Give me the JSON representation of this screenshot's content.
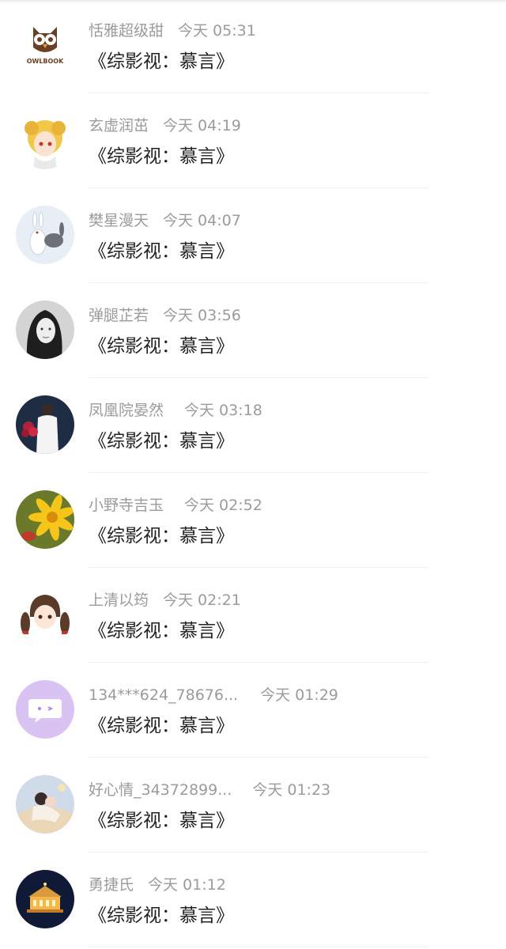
{
  "comments": [
    {
      "user": "恬雅超级甜",
      "time": "今天 05:31",
      "text": "《综影视：慕言》",
      "avatar": "owlbook-logo-icon"
    },
    {
      "user": "玄虚润茁",
      "time": "今天 04:19",
      "text": "《综影视：慕言》",
      "avatar": "anime-girl-avatar"
    },
    {
      "user": "樊星漫天",
      "time": "今天 04:07",
      "text": "《综影视：慕言》",
      "avatar": "rabbits-avatar"
    },
    {
      "user": "弹腿芷若",
      "time": "今天 03:56",
      "text": "《综影视：慕言》",
      "avatar": "woman-portrait-avatar"
    },
    {
      "user": "凤凰院晏然",
      "time": "今天 03:18",
      "text": "《综影视：慕言》",
      "avatar": "man-with-flowers-avatar"
    },
    {
      "user": "小野寺吉玉",
      "time": "今天 02:52",
      "text": "《综影视：慕言》",
      "avatar": "yellow-flower-avatar"
    },
    {
      "user": "上清以筠",
      "time": "今天 02:21",
      "text": "《综影视：慕言》",
      "avatar": "anime-pigtails-avatar"
    },
    {
      "user": "134***624_78676...",
      "time": "今天 01:29",
      "text": "《综影视：慕言》",
      "avatar": "chat-bubble-default-avatar"
    },
    {
      "user": "好心情_34372899...",
      "time": "今天 01:23",
      "text": "《综影视：慕言》",
      "avatar": "couple-illustration-avatar"
    },
    {
      "user": "勇捷氏",
      "time": "今天 01:12",
      "text": "《综影视：慕言》",
      "avatar": "carousel-night-avatar"
    }
  ],
  "logo_text": "OWLBOOK",
  "colors": {
    "username": "#9b9b9b",
    "comment": "#222222",
    "divider": "#eeeeee",
    "default_avatar": "#d9c3f3"
  }
}
